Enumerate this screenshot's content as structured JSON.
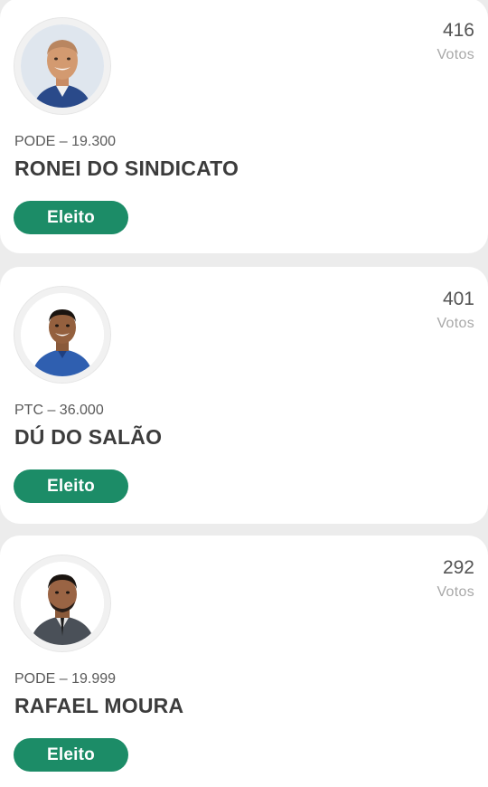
{
  "candidates": [
    {
      "votes": "416",
      "votes_label": "Votos",
      "party": "PODE – 19.300",
      "name": "RONEI DO SINDICATO",
      "status": "Eleito"
    },
    {
      "votes": "401",
      "votes_label": "Votos",
      "party": "PTC – 36.000",
      "name": "DÚ DO SALÃO",
      "status": "Eleito"
    },
    {
      "votes": "292",
      "votes_label": "Votos",
      "party": "PODE – 19.999",
      "name": "RAFAEL MOURA",
      "status": "Eleito"
    }
  ],
  "colors": {
    "badge": "#1c8c67",
    "background": "#ececec",
    "card": "#ffffff"
  }
}
